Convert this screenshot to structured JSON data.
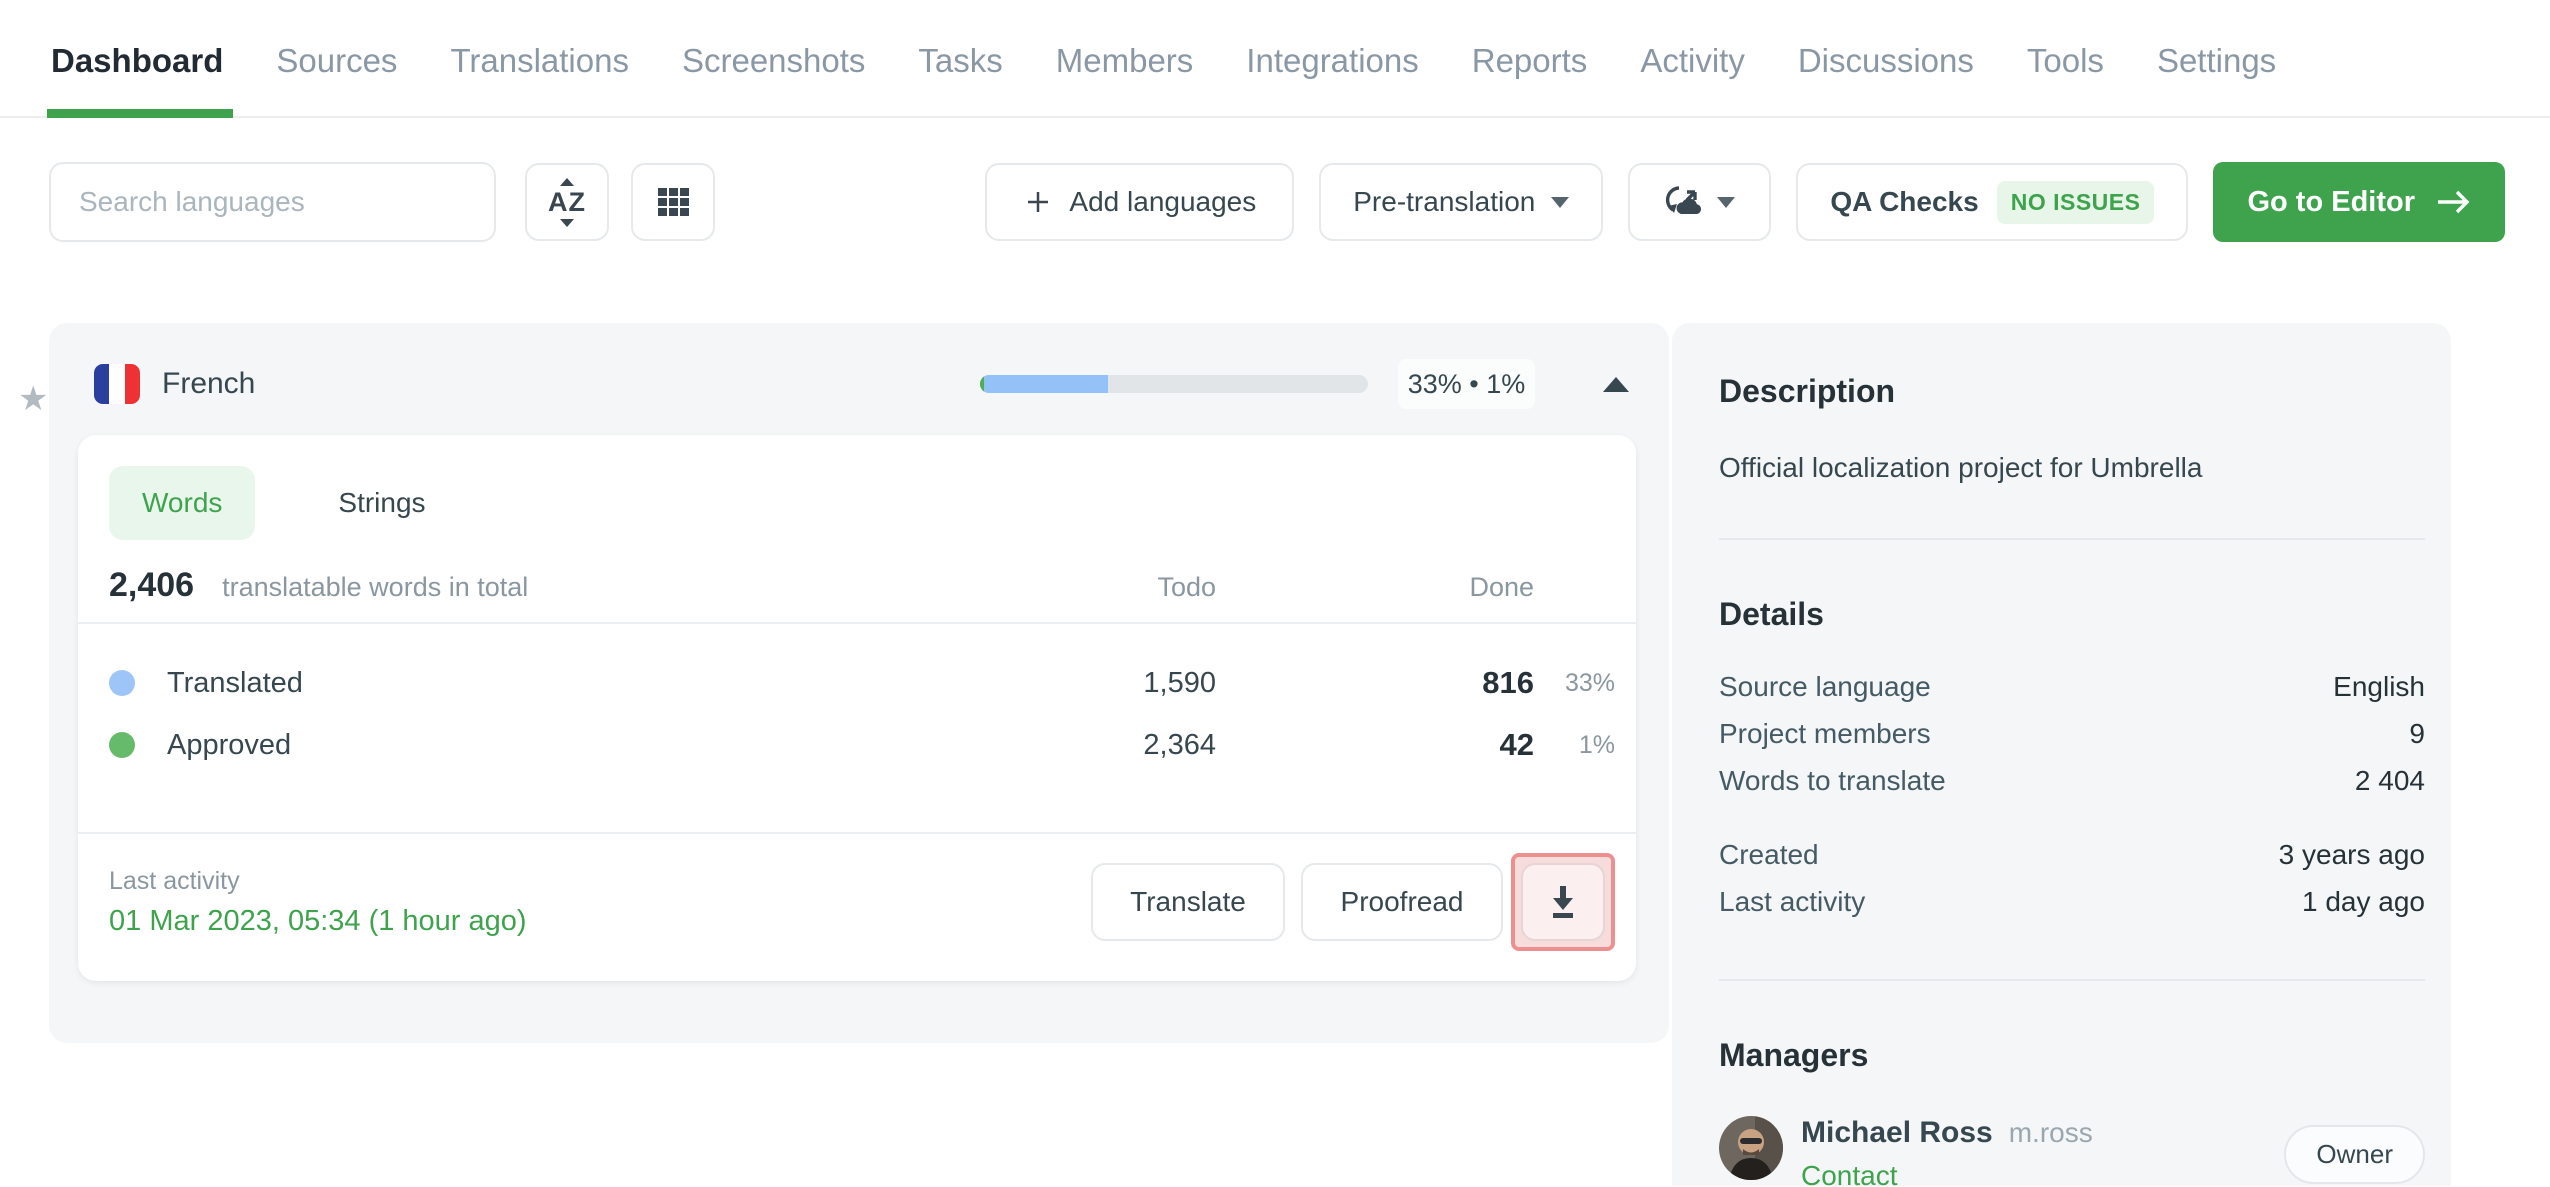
{
  "nav": {
    "tabs": [
      {
        "label": "Dashboard",
        "active": true
      },
      {
        "label": "Sources",
        "active": false
      },
      {
        "label": "Translations",
        "active": false
      },
      {
        "label": "Screenshots",
        "active": false
      },
      {
        "label": "Tasks",
        "active": false
      },
      {
        "label": "Members",
        "active": false
      },
      {
        "label": "Integrations",
        "active": false
      },
      {
        "label": "Reports",
        "active": false
      },
      {
        "label": "Activity",
        "active": false
      },
      {
        "label": "Discussions",
        "active": false
      },
      {
        "label": "Tools",
        "active": false
      },
      {
        "label": "Settings",
        "active": false
      }
    ]
  },
  "toolbar": {
    "search_placeholder": "Search languages",
    "add_languages_label": "Add languages",
    "pre_translation_label": "Pre-translation",
    "qa_checks_label": "QA Checks",
    "qa_status": "NO ISSUES",
    "go_to_editor_label": "Go to Editor"
  },
  "language_card": {
    "language": "French",
    "progress": {
      "translated_pct": 33,
      "approved_pct": 1,
      "label": "33% • 1%"
    },
    "tabs": {
      "words": "Words",
      "strings": "Strings"
    },
    "total": {
      "value": "2,406",
      "label": "translatable words in total"
    },
    "columns": {
      "todo": "Todo",
      "done": "Done"
    },
    "rows": [
      {
        "name": "Translated",
        "todo": "1,590",
        "done": "816",
        "pct": "33%",
        "color": "#9ec5f8"
      },
      {
        "name": "Approved",
        "todo": "2,364",
        "done": "42",
        "pct": "1%",
        "color": "#66bb6a"
      }
    ],
    "footer": {
      "last_activity_label": "Last activity",
      "last_activity_value": "01 Mar 2023, 05:34 (1 hour ago)",
      "translate_label": "Translate",
      "proofread_label": "Proofread"
    }
  },
  "sidebar": {
    "description": {
      "title": "Description",
      "text": "Official localization project for Umbrella"
    },
    "details": {
      "title": "Details",
      "rows": [
        {
          "label": "Source language",
          "value": "English"
        },
        {
          "label": "Project members",
          "value": "9"
        },
        {
          "label": "Words to translate",
          "value": "2 404"
        },
        {
          "label": "Created",
          "value": "3 years ago"
        },
        {
          "label": "Last activity",
          "value": "1 day ago"
        }
      ]
    },
    "managers": {
      "title": "Managers",
      "manager": {
        "name": "Michael Ross",
        "username": "m.ross",
        "contact_label": "Contact",
        "role": "Owner"
      }
    }
  },
  "colors": {
    "accent_green": "#3fa34d",
    "translated_blue": "#94c1f7",
    "approved_green": "#66bb6a",
    "annotation_red": "#ee8f8f"
  }
}
